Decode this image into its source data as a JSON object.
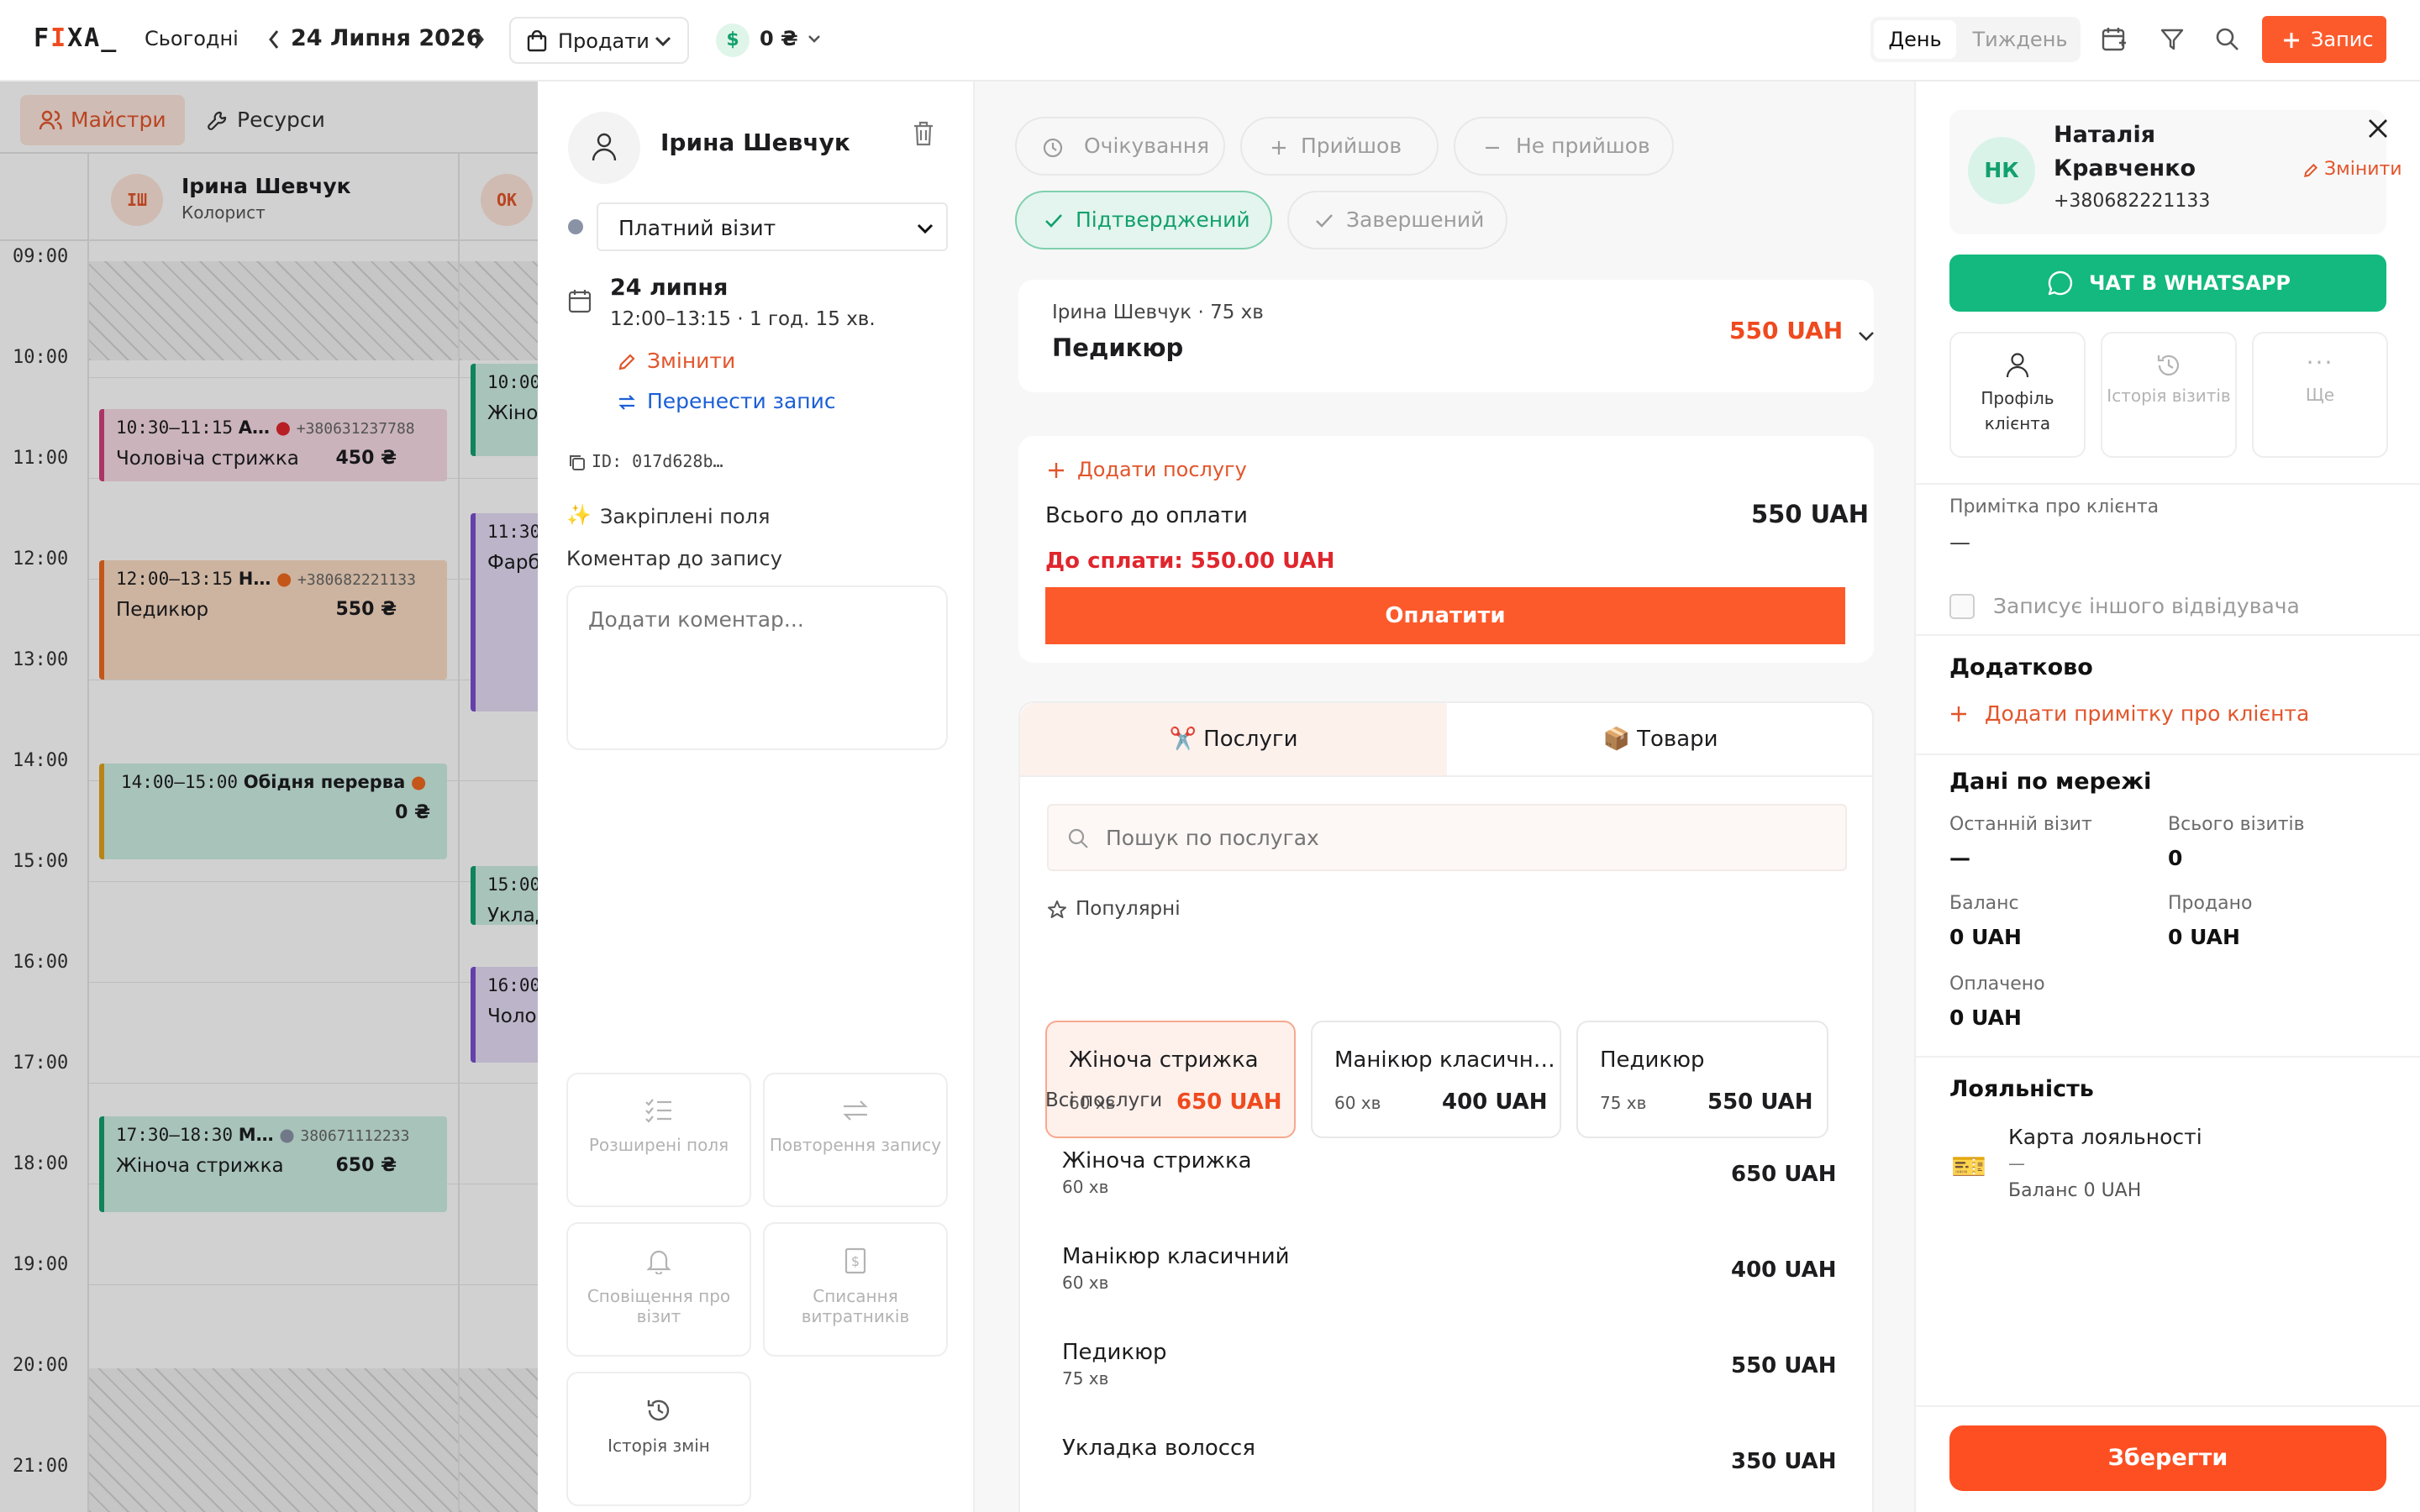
{
  "app": {
    "logo_prefix": "F",
    "logo_mid": "I",
    "logo_suffix": "XA_"
  },
  "topbar": {
    "today": "Сьогодні",
    "date": "24 Липня 2026",
    "sell": "Продати",
    "cash": "0 ₴",
    "view_day": "День",
    "view_week": "Тиждень",
    "new_record": "Запис"
  },
  "calendar": {
    "tabs": [
      "Майстри",
      "Ресурси"
    ],
    "masters": [
      {
        "initials": "ІШ",
        "name": "Ірина Шевчук",
        "role": "Колорист"
      },
      {
        "initials": "ОК"
      }
    ],
    "hours": [
      "09:00",
      "10:00",
      "11:00",
      "12:00",
      "13:00",
      "14:00",
      "15:00",
      "16:00",
      "17:00",
      "18:00",
      "19:00",
      "20:00",
      "21:00"
    ],
    "events": [
      {
        "time": "10:30–11:15",
        "client": "А…",
        "phone": "+380631237788",
        "service": "Чоловіча стрижка",
        "price": "450 ₴"
      },
      {
        "time": "12:00–13:15",
        "client": "Н…",
        "phone": "+380682221133",
        "service": "Педикюр",
        "price": "550 ₴"
      },
      {
        "time": "14:00–15:00",
        "client": "Обідня перерва",
        "price": "0 ₴"
      },
      {
        "time": "17:30–18:30",
        "client": "М…",
        "phone": "380671112233",
        "service": "Жіноча стрижка",
        "price": "650 ₴"
      }
    ],
    "events2": [
      {
        "time": "10:00",
        "service": "Жіно"
      },
      {
        "time": "11:30",
        "service": "Фарб"
      },
      {
        "time": "15:00",
        "service": "Уклад"
      },
      {
        "time": "16:00",
        "service": "Чоло"
      }
    ]
  },
  "appointment": {
    "master_name": "Ірина Шевчук",
    "visit_type": "Платний візит",
    "date": "24 липня",
    "time_range": "12:00–13:15 · 1 год. 15 хв.",
    "change": "Змінити",
    "move": "Перенести запис",
    "id": "ID: 017d628b…",
    "pinned": "Закріплені поля",
    "comment_label": "Коментар до запису",
    "comment_placeholder": "Додати коментар...",
    "tiles": [
      "Розширені поля",
      "Повторення запису",
      "Сповіщення про візит",
      "Списання витратників",
      "Історія змін"
    ]
  },
  "status": {
    "waiting": "Очікування",
    "arrived": "Прийшов",
    "not_arrived": "Не прийшов",
    "confirmed": "Підтверджений",
    "completed": "Завершений"
  },
  "service_card": {
    "meta": "Ірина Шевчук · 75 хв",
    "name": "Педикюр",
    "price": "550 UAH"
  },
  "payment": {
    "add_service": "Додати послугу",
    "total_label": "Всього до оплати",
    "total_value": "550 UAH",
    "due": "До сплати: 550.00 UAH",
    "pay_button": "Оплатити"
  },
  "catalog": {
    "tab_services": "✂️ Послуги",
    "tab_goods": "📦 Товари",
    "search_placeholder": "Пошук по послугах",
    "popular_title": "Популярні",
    "popular": [
      {
        "name": "Жіноча стрижка",
        "duration": "60 хв",
        "price": "650 UAH"
      },
      {
        "name": "Манікюр класичн…",
        "duration": "60 хв",
        "price": "400 UAH"
      },
      {
        "name": "Педикюр",
        "duration": "75 хв",
        "price": "550 UAH"
      }
    ],
    "all_title": "Всі послуги",
    "all": [
      {
        "name": "Жіноча стрижка",
        "duration": "60 хв",
        "price": "650 UAH"
      },
      {
        "name": "Манікюр класичний",
        "duration": "60 хв",
        "price": "400 UAH"
      },
      {
        "name": "Педикюр",
        "duration": "75 хв",
        "price": "550 UAH"
      },
      {
        "name": "Укладка волосся",
        "duration": "",
        "price": "350 UAH"
      }
    ]
  },
  "client": {
    "initials": "НК",
    "name_line1": "Наталія",
    "name_line2": "Кравченко",
    "phone": "+380682221133",
    "change": "Змінити",
    "whatsapp": "ЧАТ В WHATSAPP",
    "tiles": [
      "Профіль клієнта",
      "Історія візитів",
      "Ще"
    ],
    "note_label": "Примітка про клієнта",
    "note_value": "—",
    "other_visitor": "Записує іншого відвідувача",
    "extra_title": "Додатково",
    "add_note": "Додати примітку про клієнта",
    "network_title": "Дані по мережі",
    "last_visit_label": "Останній візит",
    "last_visit_value": "—",
    "total_visits_label": "Всього візитів",
    "total_visits_value": "0",
    "balance_label": "Баланс",
    "balance_value": "0 UAH",
    "sold_label": "Продано",
    "sold_value": "0 UAH",
    "paid_label": "Оплачено",
    "paid_value": "0 UAH",
    "loyalty_title": "Лояльність",
    "loyalty_card": "Карта лояльності",
    "loyalty_dash": "—",
    "loyalty_balance": "Баланс 0 UAH",
    "save": "Зберегти"
  },
  "colors": {
    "accent": "#fd5a2c",
    "whatsapp": "#13b97e",
    "confirmed": "#13a06d",
    "danger": "#e0262d"
  }
}
